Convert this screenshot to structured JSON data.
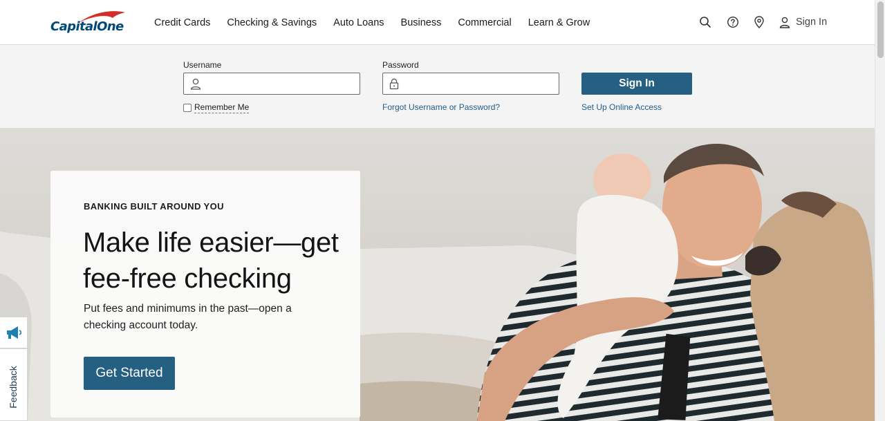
{
  "header": {
    "logo": {
      "text": "CapitalOne"
    },
    "nav": [
      {
        "label": "Credit Cards"
      },
      {
        "label": "Checking & Savings"
      },
      {
        "label": "Auto Loans"
      },
      {
        "label": "Business"
      },
      {
        "label": "Commercial"
      },
      {
        "label": "Learn & Grow"
      }
    ],
    "utility_icons": [
      "search-icon",
      "help-icon",
      "location-pin-icon"
    ],
    "sign_in_label": "Sign In"
  },
  "login": {
    "username_label": "Username",
    "username_value": "",
    "password_label": "Password",
    "password_value": "",
    "remember_label": "Remember Me",
    "remember_checked": false,
    "forgot_link": "Forgot Username or Password?",
    "sign_in_button": "Sign In",
    "setup_link": "Set Up Online Access"
  },
  "hero": {
    "eyebrow": "BANKING BUILT AROUND YOU",
    "headline": "Make life easier—get fee-free checking",
    "subtext": "Put fees and minimums in the past—open a checking account today.",
    "cta_label": "Get Started"
  },
  "feedback": {
    "label": "Feedback",
    "icon": "megaphone-icon"
  },
  "colors": {
    "brand_blue": "#004879",
    "brand_red": "#d03027",
    "button_blue": "#255f82",
    "link_blue": "#1f5c8b",
    "band_gray": "#f4f4f4"
  }
}
